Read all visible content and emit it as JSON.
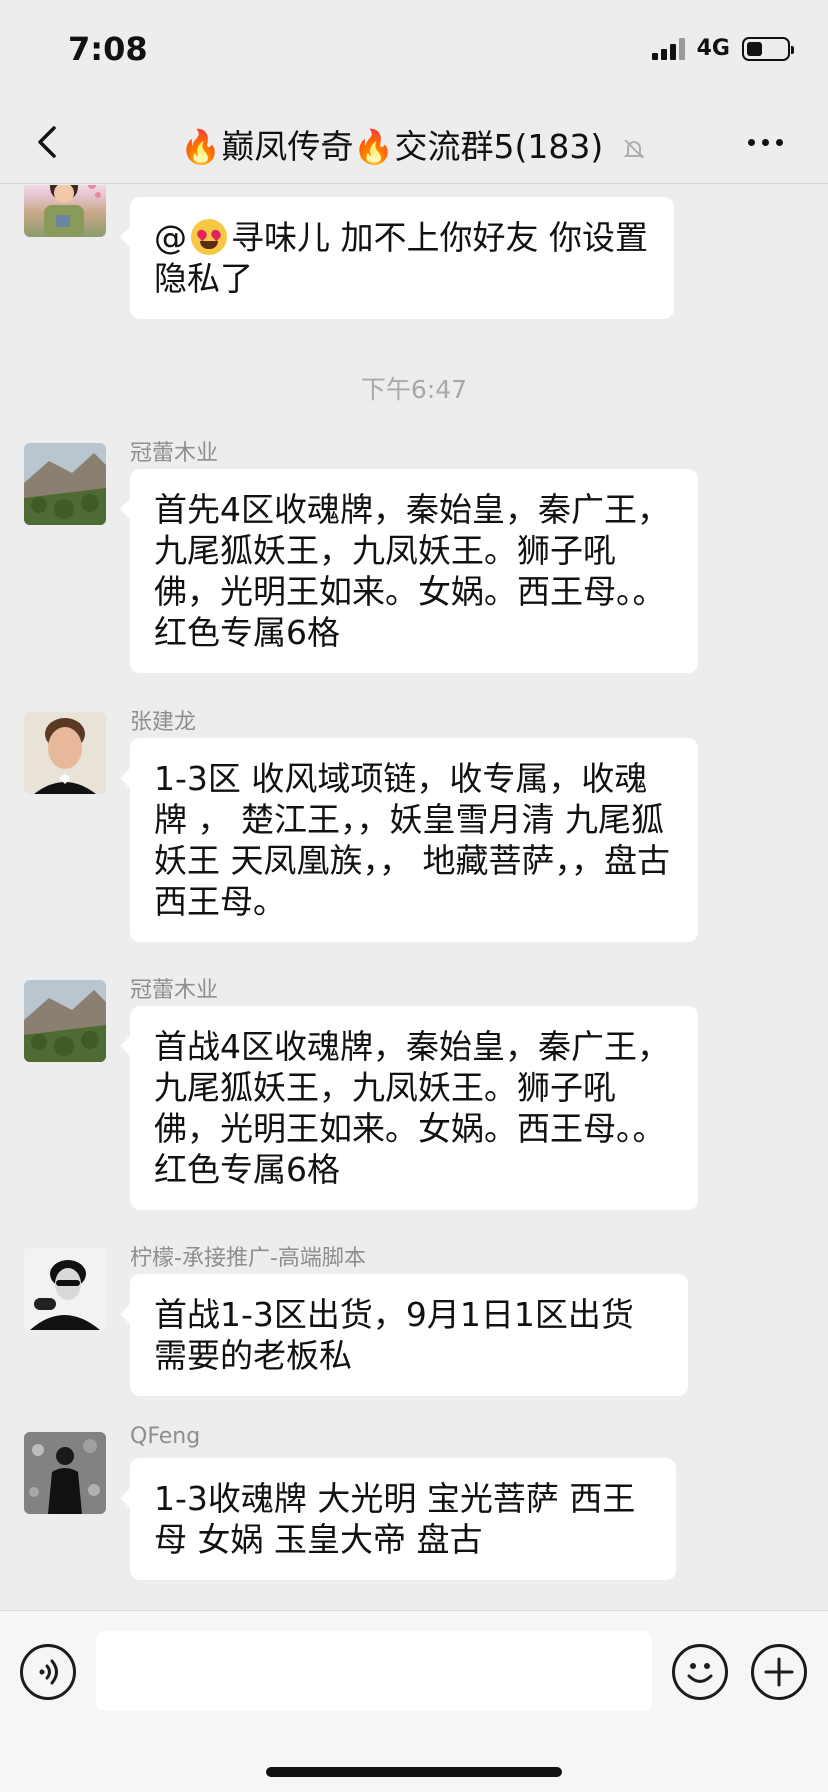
{
  "status_bar": {
    "time": "7:08",
    "network": "4G"
  },
  "nav": {
    "title_part1": "巅凤传奇",
    "title_part2": "交流群5(183)",
    "fire_icon": "fire-emoji-icon"
  },
  "messages": [
    {
      "sender": "",
      "text_after_emoji": "寻味儿 加不上你好友  你设置隐私了",
      "text_before_emoji": "@"
    },
    {
      "sender": "冠蕾木业",
      "text": "首先4区收魂牌，秦始皇，秦广王，九尾狐妖王，九凤妖王。狮子吼佛，光明王如来。女娲。西王母。。红色专属6格"
    },
    {
      "sender": "张建龙",
      "text": "1-3区 收风域项链，收专属，收魂牌 ，  楚江王，，妖皇雪月清 九尾狐妖王 天凤凰族，，  地藏菩萨，，盘古   西王母。"
    },
    {
      "sender": "冠蕾木业",
      "text": "首战4区收魂牌，秦始皇，秦广王，九尾狐妖王，九凤妖王。狮子吼佛，光明王如来。女娲。西王母。。红色专属6格"
    },
    {
      "sender": "柠檬-承接推广-高端脚本",
      "text": "首战1-3区出货，9月1日1区出货需要的老板私"
    },
    {
      "sender": "QFeng",
      "text": "1-3收魂牌 大光明 宝光菩萨 西王母 女娲 玉皇大帝 盘古"
    }
  ],
  "time_separator": "下午6:47",
  "colors": {
    "background": "#ededed",
    "bubble": "#ffffff",
    "sender": "#8e8e8e"
  }
}
